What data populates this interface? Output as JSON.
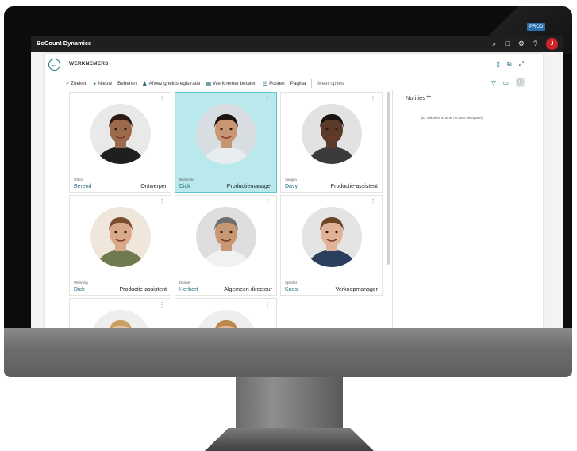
{
  "app": {
    "title": "BoCount Dynamics",
    "user_initial": "J",
    "env_badge": "PROD"
  },
  "page": {
    "title": "WERKNEMERS"
  },
  "actions": [
    {
      "icon": "search-icon",
      "label": "Zoeken"
    },
    {
      "icon": "plus-icon",
      "label": "Nieuw"
    },
    {
      "icon": "",
      "label": "Beheren"
    },
    {
      "icon": "people-icon",
      "label": "Afwezigheidsregistratie"
    },
    {
      "icon": "pay-icon",
      "label": "Werknemer betalen"
    },
    {
      "icon": "list-icon",
      "label": "Posten"
    },
    {
      "icon": "",
      "label": "Pagina"
    },
    {
      "icon": "",
      "label": "Meer opties"
    }
  ],
  "employees": [
    {
      "last": "Otten",
      "first": "Berend",
      "role": "Ontwerper",
      "selected": false,
      "skin": "#9a6a4a",
      "hair": "#2a1a12",
      "shirt": "#1f1f1f",
      "bg": "#e9e9e9"
    },
    {
      "last": "Beekman",
      "first": "Dick",
      "role": "Productiemanager",
      "selected": true,
      "skin": "#c99673",
      "hair": "#1d140f",
      "shirt": "#e8edf1",
      "bg": "#d8dde1"
    },
    {
      "last": "Vliegen",
      "first": "Davy",
      "role": "Productie-assistent",
      "selected": false,
      "skin": "#5b3a2a",
      "hair": "#1a1210",
      "shirt": "#3b3b3b",
      "bg": "#e2e2e2"
    },
    {
      "last": "Wenning",
      "first": "Dick",
      "role": "Productie-assistent",
      "selected": false,
      "skin": "#d9a98a",
      "hair": "#7a4e2c",
      "shirt": "#6f7a4e",
      "bg": "#efe6dc"
    },
    {
      "last": "Donner",
      "first": "Herbert",
      "role": "Algemeen directeur",
      "selected": false,
      "skin": "#c89774",
      "hair": "#6e6e6e",
      "shirt": "#f1f1f1",
      "bg": "#dedede"
    },
    {
      "last": "Splinter",
      "first": "Koos",
      "role": "Verkoopmanager",
      "selected": false,
      "skin": "#e0b398",
      "hair": "#6a4524",
      "shirt": "#2c3e5e",
      "bg": "#e4e4e4"
    },
    {
      "last": "",
      "first": "",
      "role": "",
      "selected": false,
      "skin": "#e8c2a6",
      "hair": "#c9a064",
      "shirt": "#ffffff",
      "bg": "#eeeeee"
    },
    {
      "last": "",
      "first": "",
      "role": "",
      "selected": false,
      "skin": "#e2b896",
      "hair": "#b8884c",
      "shirt": "#ffffff",
      "bg": "#eeeeee"
    }
  ],
  "notes": {
    "title": "Notities",
    "empty": "(Er valt niets te tonen in deze weergave)"
  },
  "colors": {
    "accent": "#1f6f78",
    "selected": "#b9e9ec",
    "topbar": "#1f1f1f"
  }
}
